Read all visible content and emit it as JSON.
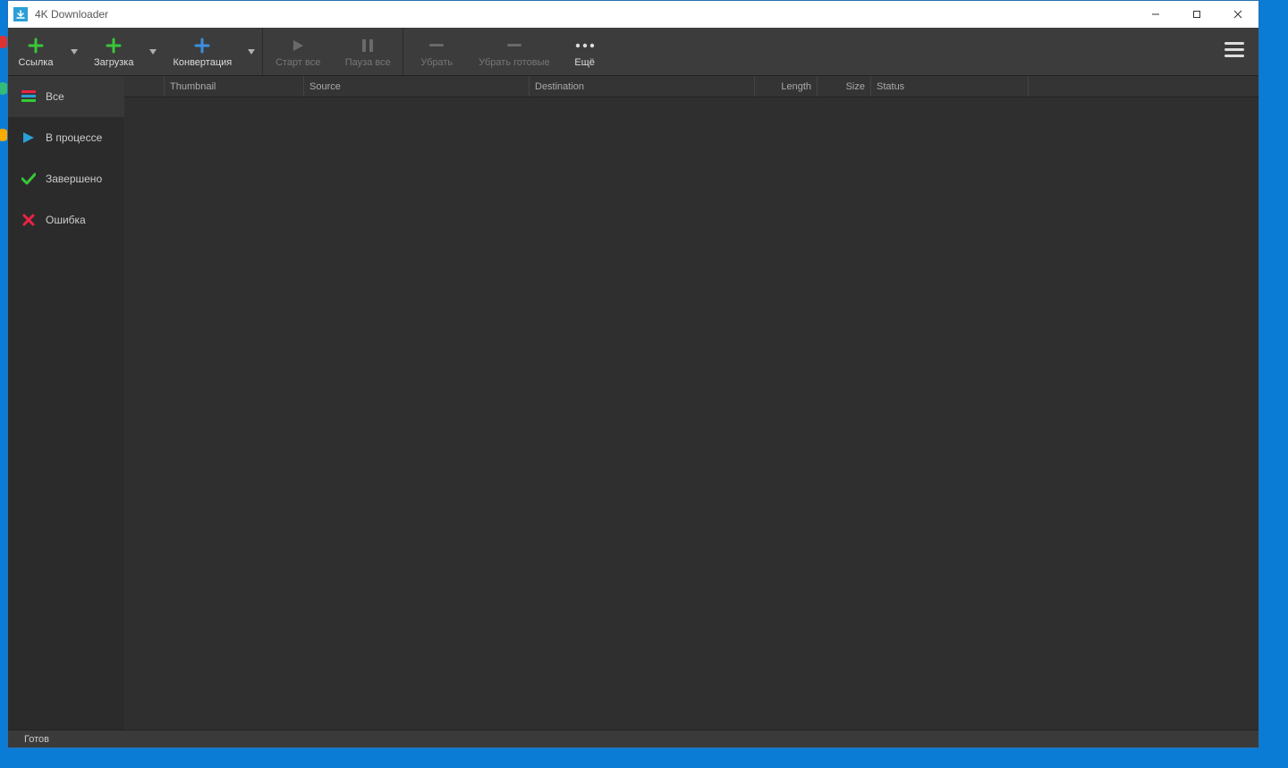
{
  "window": {
    "title": "4K Downloader"
  },
  "toolbar": {
    "link_label": "Ссылка",
    "download_label": "Загрузка",
    "convert_label": "Конвертация",
    "start_all_label": "Старт все",
    "pause_all_label": "Пауза все",
    "remove_label": "Убрать",
    "remove_done_label": "Убрать готовые",
    "more_label": "Ещё"
  },
  "sidebar": {
    "items": [
      {
        "label": "Все"
      },
      {
        "label": "В процессе"
      },
      {
        "label": "Завершено"
      },
      {
        "label": "Ошибка"
      }
    ]
  },
  "columns": {
    "thumbnail": "Thumbnail",
    "source": "Source",
    "destination": "Destination",
    "length": "Length",
    "size": "Size",
    "status": "Status"
  },
  "statusbar": {
    "text": "Готов"
  }
}
